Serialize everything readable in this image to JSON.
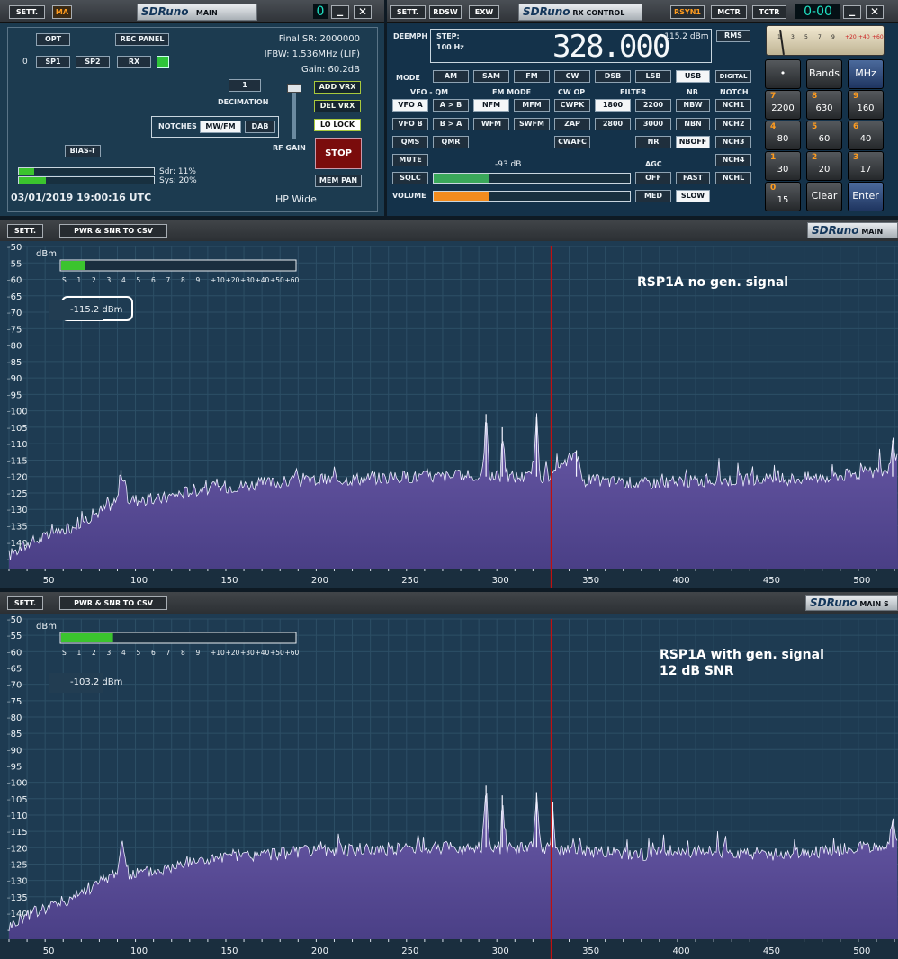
{
  "main": {
    "sett": "SETT.",
    "ma": "MA",
    "title_brand": "SDRuno",
    "title": "MAIN",
    "counter": "0",
    "opt": "OPT",
    "rec_panel": "REC PANEL",
    "zero": "0",
    "sp1": "SP1",
    "sp2": "SP2",
    "rx": "RX",
    "final_sr": "Final SR: 2000000",
    "ifbw": "IFBW: 1.536MHz (LIF)",
    "gain": "Gain: 60.2dB",
    "decimation_value": "1",
    "decimation": "DECIMATION",
    "add_vrx": "ADD VRX",
    "del_vrx": "DEL VRX",
    "lo_lock": "LO LOCK",
    "stop": "STOP",
    "mem_pan": "MEM PAN",
    "notches": "NOTCHES",
    "mw_fm": "MW/FM",
    "dab": "DAB",
    "rf_gain": "RF GAIN",
    "bias_t": "BIAS-T",
    "sdr": "Sdr: 11%",
    "sys": "Sys: 20%",
    "sdr_pct": 0.11,
    "sys_pct": 0.2,
    "datetime": "03/01/2019 19:00:16 UTC",
    "hp_wide": "HP Wide"
  },
  "rx": {
    "sett": "SETT.",
    "rdsw": "RDSW",
    "exw": "EXW",
    "title_brand": "SDRuno",
    "title": "RX CONTROL",
    "rsyn1": "RSYN1",
    "mctr": "MCTR",
    "tctr": "TCTR",
    "counter": "0-00",
    "deemph": "DEEMPH",
    "step": "STEP:",
    "step_val": "100 Hz",
    "freq": "328.000",
    "level": "-115.2 dBm",
    "rms": "RMS",
    "mode": "MODE",
    "modes": [
      "AM",
      "SAM",
      "FM",
      "CW",
      "DSB",
      "LSB",
      "USB",
      "DIGITAL"
    ],
    "vfo_qm": "VFO - QM",
    "fm_mode": "FM MODE",
    "cw_op": "CW OP",
    "filter": "FILTER",
    "nb": "NB",
    "notch": "NOTCH",
    "vfo_a": "VFO A",
    "a_b": "A > B",
    "nfm": "NFM",
    "mfm": "MFM",
    "cwpk": "CWPK",
    "f1800": "1800",
    "f2200": "2200",
    "nbw": "NBW",
    "nch1": "NCH1",
    "vfo_b": "VFO B",
    "b_a": "B > A",
    "wfm": "WFM",
    "swfm": "SWFM",
    "zap": "ZAP",
    "f2800": "2800",
    "f3000": "3000",
    "nbn": "NBN",
    "nch2": "NCH2",
    "qms": "QMS",
    "qmr": "QMR",
    "cwafc": "CWAFC",
    "nr": "NR",
    "nboff": "NBOFF",
    "nch3": "NCH3",
    "mute": "MUTE",
    "sqlc": "SQLC",
    "volume": "VOLUME",
    "sql_db": "-93 dB",
    "agc": "AGC",
    "off": "OFF",
    "fast": "FAST",
    "med": "MED",
    "slow": "SLOW",
    "nch4": "NCH4",
    "nchl": "NCHL",
    "sql_level": 0.28,
    "volume_level": 0.28,
    "scale_digits": [
      "1",
      "3",
      "5",
      "7",
      "9",
      "+20",
      "+40",
      "+60"
    ],
    "pad": [
      {
        "n": "",
        "v": "•"
      },
      {
        "n": "",
        "v": "Bands"
      },
      {
        "n": "",
        "v": "MHz"
      },
      {
        "n": "7",
        "v": "2200"
      },
      {
        "n": "8",
        "v": "630"
      },
      {
        "n": "9",
        "v": "160"
      },
      {
        "n": "4",
        "v": "80"
      },
      {
        "n": "5",
        "v": "60"
      },
      {
        "n": "6",
        "v": "40"
      },
      {
        "n": "1",
        "v": "30"
      },
      {
        "n": "2",
        "v": "20"
      },
      {
        "n": "3",
        "v": "17"
      },
      {
        "n": "0",
        "v": "15"
      },
      {
        "n": "",
        "v": "Clear"
      },
      {
        "n": "",
        "v": "Enter"
      }
    ]
  },
  "spectra": [
    {
      "sett": "SETT.",
      "pwr": "PWR & SNR TO CSV",
      "brand": "SDRuno",
      "title": "MAIN",
      "unit": "dBm",
      "smeter": [
        "S",
        "1",
        "2",
        "3",
        "4",
        "5",
        "6",
        "7",
        "8",
        "9",
        "+10",
        "+20",
        "+30",
        "+40",
        "+50",
        "+60"
      ],
      "smeter_level": 0.1,
      "readout": "-115.2 dBm",
      "note1": "RSP1A no gen. signal",
      "note2": ""
    },
    {
      "sett": "SETT.",
      "pwr": "PWR & SNR TO CSV",
      "brand": "SDRuno",
      "title": "MAIN S",
      "unit": "dBm",
      "smeter": [
        "S",
        "1",
        "2",
        "3",
        "4",
        "5",
        "6",
        "7",
        "8",
        "9",
        "+10",
        "+20",
        "+30",
        "+40",
        "+50",
        "+60"
      ],
      "smeter_level": 0.22,
      "readout": "-103.2 dBm",
      "note1": "RSP1A with gen. signal",
      "note2": "12 dB SNR"
    }
  ],
  "chart_data": [
    {
      "type": "line",
      "xlabel": "",
      "ylabel": "dBm",
      "x_ticks": [
        50,
        100,
        150,
        200,
        250,
        300,
        350,
        400,
        450,
        500
      ],
      "y_ticks": [
        -50,
        -55,
        -60,
        -65,
        -70,
        -75,
        -80,
        -85,
        -90,
        -95,
        -100,
        -105,
        -110,
        -115,
        -120,
        -125,
        -130,
        -135,
        -140,
        -145
      ],
      "xlim": [
        28,
        520
      ],
      "ylim": [
        -148,
        -50
      ],
      "marker_x": 328,
      "series": [
        {
          "values": [
            [
              28,
              -144
            ],
            [
              40,
              -140
            ],
            [
              50,
              -138
            ],
            [
              60,
              -136
            ],
            [
              70,
              -133
            ],
            [
              80,
              -130
            ],
            [
              88,
              -127
            ],
            [
              90,
              -118
            ],
            [
              94,
              -127
            ],
            [
              110,
              -127
            ],
            [
              130,
              -124
            ],
            [
              150,
              -123
            ],
            [
              170,
              -122
            ],
            [
              200,
              -121
            ],
            [
              250,
              -120
            ],
            [
              290,
              -120
            ],
            [
              292,
              -101
            ],
            [
              294,
              -120
            ],
            [
              300,
              -120
            ],
            [
              301,
              -105
            ],
            [
              303,
              -120
            ],
            [
              318,
              -120
            ],
            [
              320,
              -102
            ],
            [
              322,
              -120
            ],
            [
              330,
              -120
            ],
            [
              342,
              -112
            ],
            [
              345,
              -121
            ],
            [
              380,
              -122
            ],
            [
              420,
              -121
            ],
            [
              450,
              -121
            ],
            [
              480,
              -120
            ],
            [
              500,
              -119
            ],
            [
              515,
              -118
            ],
            [
              517,
              -109
            ],
            [
              520,
              -116
            ]
          ]
        }
      ],
      "peaks": [
        {
          "x": 22,
          "y": -131
        },
        {
          "x": 90,
          "y": -118
        },
        {
          "x": 292,
          "y": -101
        },
        {
          "x": 301,
          "y": -105
        },
        {
          "x": 320,
          "y": -102
        },
        {
          "x": 342,
          "y": -112
        },
        {
          "x": 517,
          "y": -109
        }
      ]
    },
    {
      "type": "line",
      "xlabel": "",
      "ylabel": "dBm",
      "x_ticks": [
        50,
        100,
        150,
        200,
        250,
        300,
        350,
        400,
        450,
        500
      ],
      "y_ticks": [
        -50,
        -55,
        -60,
        -65,
        -70,
        -75,
        -80,
        -85,
        -90,
        -95,
        -100,
        -105,
        -110,
        -115,
        -120,
        -125,
        -130,
        -135,
        -140,
        -145
      ],
      "xlim": [
        28,
        520
      ],
      "ylim": [
        -148,
        -50
      ],
      "marker_x": 328,
      "series": [
        {
          "values": [
            [
              28,
              -144
            ],
            [
              40,
              -140
            ],
            [
              50,
              -138
            ],
            [
              60,
              -136
            ],
            [
              70,
              -133
            ],
            [
              80,
              -130
            ],
            [
              88,
              -127
            ],
            [
              90,
              -119
            ],
            [
              94,
              -128
            ],
            [
              110,
              -127
            ],
            [
              130,
              -124
            ],
            [
              150,
              -123
            ],
            [
              170,
              -122
            ],
            [
              200,
              -121
            ],
            [
              250,
              -120
            ],
            [
              290,
              -120
            ],
            [
              292,
              -101
            ],
            [
              294,
              -120
            ],
            [
              300,
              -120
            ],
            [
              301,
              -104
            ],
            [
              303,
              -120
            ],
            [
              318,
              -120
            ],
            [
              320,
              -103
            ],
            [
              322,
              -120
            ],
            [
              328,
              -120
            ],
            [
              329,
              -106
            ],
            [
              330,
              -120
            ],
            [
              345,
              -121
            ],
            [
              380,
              -122
            ],
            [
              420,
              -121
            ],
            [
              450,
              -122
            ],
            [
              480,
              -121
            ],
            [
              500,
              -120
            ],
            [
              515,
              -119
            ],
            [
              517,
              -112
            ],
            [
              520,
              -118
            ]
          ]
        }
      ],
      "peaks": [
        {
          "x": 22,
          "y": -127
        },
        {
          "x": 90,
          "y": -119
        },
        {
          "x": 292,
          "y": -101
        },
        {
          "x": 301,
          "y": -104
        },
        {
          "x": 320,
          "y": -103
        },
        {
          "x": 329,
          "y": -106
        },
        {
          "x": 517,
          "y": -112
        }
      ]
    }
  ]
}
